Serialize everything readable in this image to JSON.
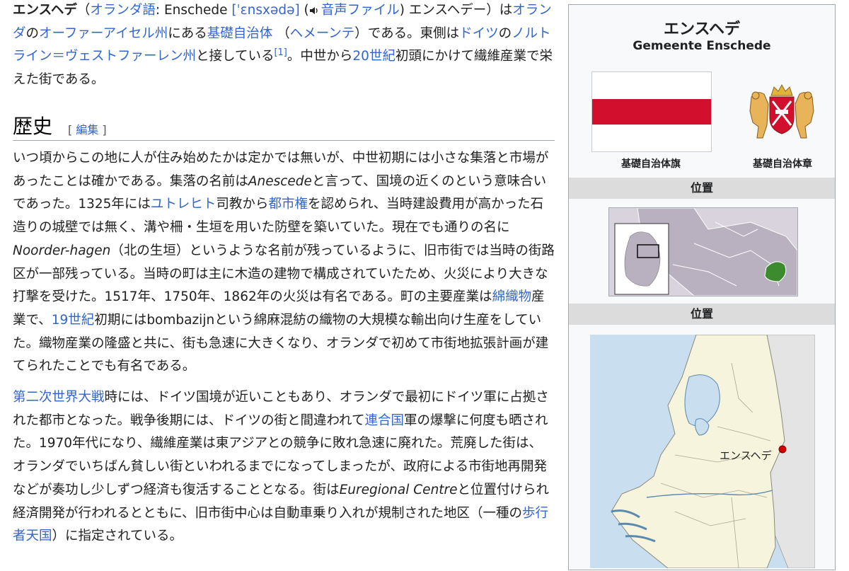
{
  "intro": {
    "term": "エンスヘデ",
    "paren_open": "（",
    "lang_link": "オランダ語",
    "colon": ": Enschede ",
    "ipa": "[ˈɛnsxədə]",
    "audio_link": "音声ファイル",
    "paren_text": "エンスヘデー）は",
    "link_netherlands": "オランダ",
    "text_no": "の",
    "link_province": "オーファーアイセル州",
    "text_niaru": "にある",
    "link_municipality": "基礎自治体",
    "text_paren_a": "（",
    "link_gemeente": "ヘメーンテ",
    "text_paren_b": "）である。東側は",
    "link_germany": "ドイツ",
    "text_no2": "の",
    "link_nrw": "ノルトライン＝ヴェストファーレン州",
    "text_border": "と接している",
    "ref": "[1]",
    "text_middle": "。中世から",
    "link_20c": "20世紀",
    "text_end": "初頭にかけて繊維産業で栄えた街である。"
  },
  "section": {
    "title": "歴史",
    "edit_open": "[ ",
    "edit_label": "編集",
    "edit_close": " ]"
  },
  "history": {
    "p1_a": "いつ頃からこの地に人が住み始めたかは定かでは無いが、中世初期には小さな集落と市場があったことは確かである。集落の名前は",
    "p1_anescede": "Anescede",
    "p1_b": "と言って、国境の近くのという意味合いであった。1325年には",
    "p1_link_utrecht": "ユトレヒト",
    "p1_c": "司教から",
    "p1_link_cityrights": "都市権",
    "p1_d": "を認められ、当時建設費用が高かった石造りの城壁では無く、溝や柵・生垣を用いた防壁を築いていた。現在でも通りの名に",
    "p1_noorder": "Noorder-hagen",
    "p1_e": "（北の生垣）というような名前が残っているように、旧市街では当時の街路区が一部残っている。当時の町は主に木造の建物で構成されていたため、火災により大きな打撃を受けた。1517年、1750年、1862年の火災は有名である。町の主要産業は",
    "p1_link_cotton": "綿織物",
    "p1_f": "産業で、",
    "p1_link_19c": "19世紀",
    "p1_g": "初期にはbombazijnという綿麻混紡の織物の大規模な輸出向け生産をしていた。織物産業の隆盛と共に、街も急速に大きくなり、オランダで初めて市街地拡張計画が建てられたことでも有名である。",
    "p2_link_ww2": "第二次世界大戦",
    "p2_a": "時には、ドイツ国境が近いこともあり、オランダで最初にドイツ軍に占拠された都市となった。戦争後期には、ドイツの街と間違われて",
    "p2_link_allies": "連合国",
    "p2_b": "軍の爆撃に何度も晒された。1970年代になり、繊維産業は東アジアとの競争に敗れ急速に廃れた。荒廃した街は、オランダでいちばん貧しい街といわれるまでになってしまったが、政府による市街地再開発などが奏功し少しずつ経済も復活することとなる。街は",
    "p2_euregional": "Euregional Centre",
    "p2_c": "と位置付けられ経済開発が行われるとともに、旧市街中心は自動車乗り入れが規制された地区（一種の",
    "p2_link_pedestrian": "歩行者天国",
    "p2_d": "）に指定されている。"
  },
  "infobox": {
    "title": "エンスヘデ",
    "subtitle": "Gemeente Enschede",
    "flag_caption": "基礎自治体旗",
    "coa_caption": "基礎自治体章",
    "location_header_1": "位置",
    "location_header_2": "位置",
    "map_label": "エンスヘデ",
    "colors": {
      "flag_red": "#d2102d",
      "flag_white": "#ffffff",
      "land": "#f7f4de",
      "water": "#c9dff0",
      "highlight": "#3d8b2f",
      "marker": "#d40000"
    }
  }
}
